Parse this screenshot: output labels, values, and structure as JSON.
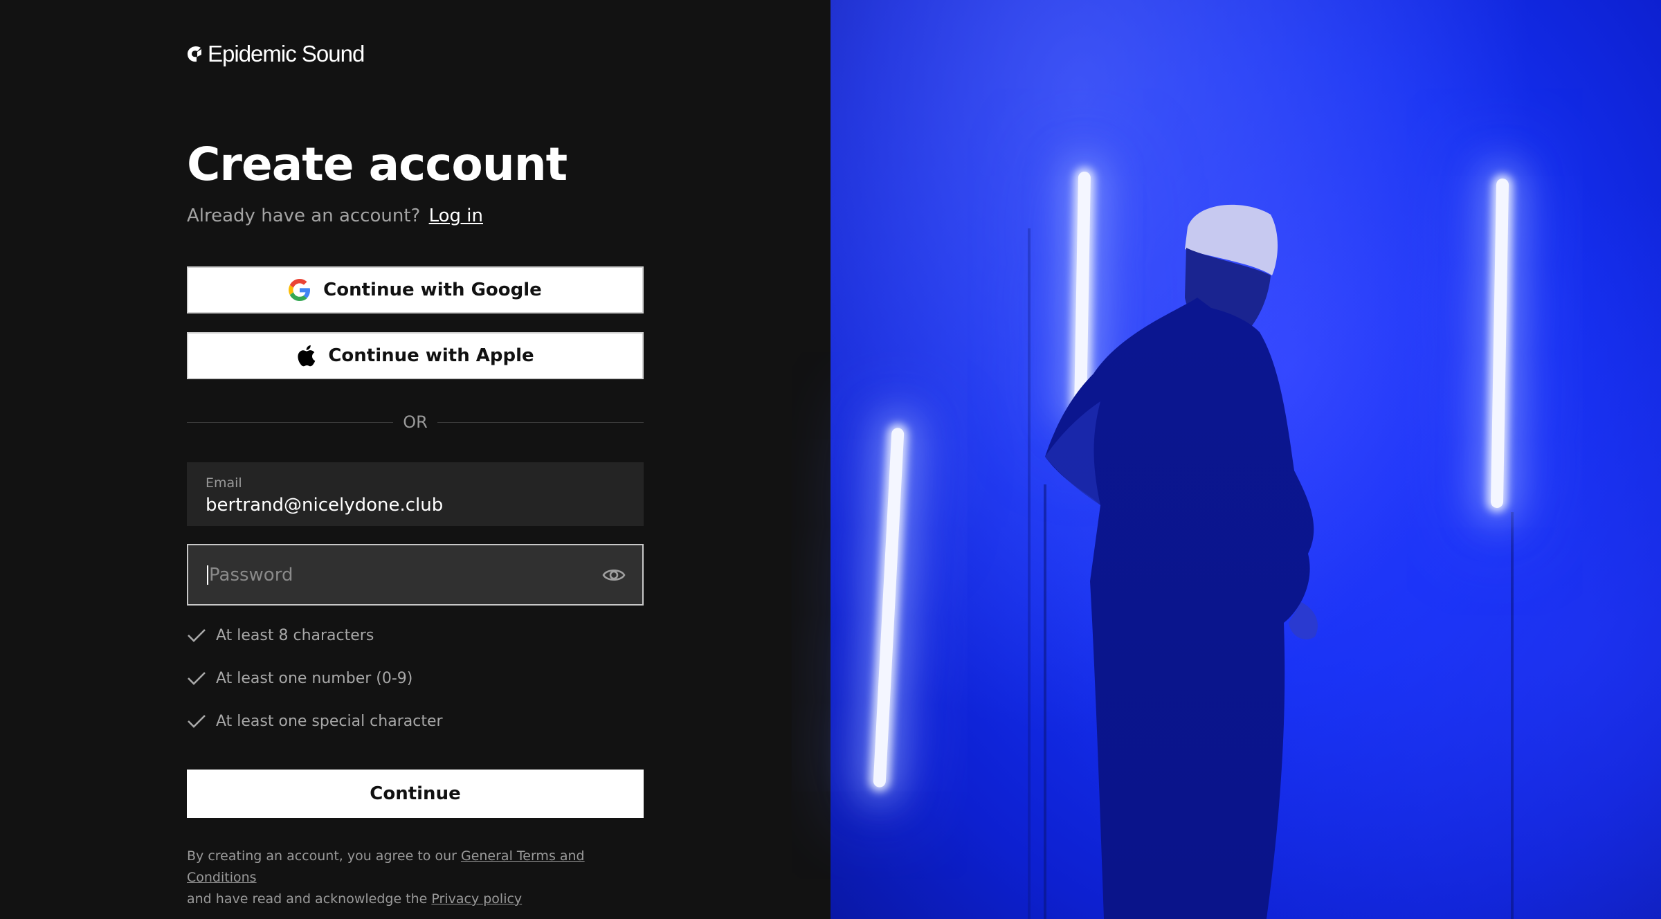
{
  "brand": {
    "name": "Epidemic Sound",
    "logo_icon": "epidemic-sound-logo-icon"
  },
  "page": {
    "title": "Create account",
    "subtitle_text": "Already have an account?",
    "login_link": "Log in"
  },
  "social": {
    "google_label": "Continue with Google",
    "google_icon": "google-icon",
    "apple_label": "Continue with Apple",
    "apple_icon": "apple-icon"
  },
  "divider": {
    "label": "OR"
  },
  "form": {
    "email": {
      "label": "Email",
      "value": "bertrand@nicelydone.club"
    },
    "password": {
      "placeholder": "Password",
      "value": "",
      "toggle_icon": "eye-icon"
    }
  },
  "requirements": [
    {
      "label": "At least 8 characters",
      "icon": "check-icon"
    },
    {
      "label": "At least one number (0-9)",
      "icon": "check-icon"
    },
    {
      "label": "At least one special character",
      "icon": "check-icon"
    }
  ],
  "actions": {
    "continue_label": "Continue"
  },
  "terms": {
    "line1_prefix": "By creating an account, you agree to our",
    "terms_link": "General Terms and Conditions",
    "line2_prefix": "and have read and acknowledge the",
    "privacy_link": "Privacy policy"
  },
  "colors": {
    "background": "#121212",
    "input_bg": "#242424",
    "photo_blue": "#1530f2",
    "button_bg": "#ffffff"
  }
}
